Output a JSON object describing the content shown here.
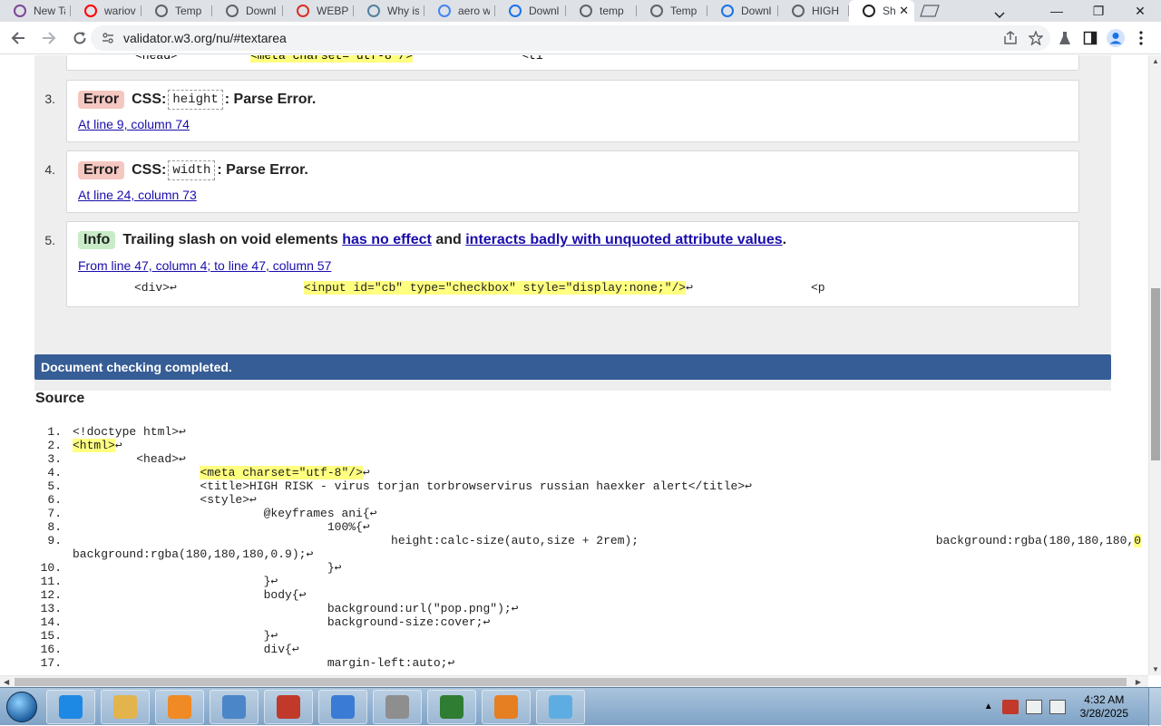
{
  "browser": {
    "tabs": [
      {
        "title": "New Tab",
        "icon": "tor-icon",
        "color": "#7d4698"
      },
      {
        "title": "wariov",
        "icon": "youtube-icon",
        "color": "#ff0000"
      },
      {
        "title": "Temp",
        "icon": "globe-icon",
        "color": "#5f6368"
      },
      {
        "title": "Downl",
        "icon": "globe-icon",
        "color": "#5f6368"
      },
      {
        "title": "WEBP",
        "icon": "webp-icon",
        "color": "#d93025"
      },
      {
        "title": "Why is",
        "icon": "java-icon",
        "color": "#5382a1"
      },
      {
        "title": "aero w",
        "icon": "google-icon",
        "color": "#4285f4"
      },
      {
        "title": "Downl",
        "icon": "diamond-icon",
        "color": "#1a73e8"
      },
      {
        "title": "temp",
        "icon": "globe-icon",
        "color": "#5f6368"
      },
      {
        "title": "Temp",
        "icon": "globe-icon",
        "color": "#5f6368"
      },
      {
        "title": "Downl",
        "icon": "download-icon",
        "color": "#1a73e8"
      },
      {
        "title": "HIGH",
        "icon": "globe-icon",
        "color": "#5f6368"
      },
      {
        "title": "Sh",
        "icon": "w3c-icon",
        "color": "#202124",
        "active": true
      }
    ],
    "close_tab": "✕",
    "url": "validator.w3.org/nu/#textarea",
    "window_controls": {
      "minimize": "—",
      "maximize": "❐",
      "close": "✕"
    }
  },
  "messages": [
    {
      "number": "3.",
      "type": "Error",
      "prefix": "CSS:",
      "code": "height",
      "text": ": Parse Error.",
      "location": "At line 9, column 74"
    },
    {
      "number": "4.",
      "type": "Error",
      "prefix": "CSS:",
      "code": "width",
      "text": ": Parse Error.",
      "location": "At line 24, column 73"
    },
    {
      "number": "5.",
      "type": "Info",
      "text_a": "Trailing slash on void elements",
      "link_a": "has no effect",
      "text_b": "and",
      "link_b": "interacts badly with unquoted attribute values",
      "text_c": ".",
      "location": "From line 47, column 4; to line 47, column 57",
      "extract_before": "<div>↩",
      "extract_highlight": "<input id=\"cb\" type=\"checkbox\" style=\"display:none;\"/>",
      "extract_after_mark": "↩",
      "extract_tail": "<p"
    }
  ],
  "partial_top": {
    "head": "<head>",
    "meta": "<meta charset=\"utf-8\"/>",
    "tail": "<ti"
  },
  "banner": "Document checking completed.",
  "source_heading": "Source",
  "source_lines": [
    {
      "n": "1.",
      "pre": "<!doctype html>↩",
      "hl": "",
      "post": ""
    },
    {
      "n": "2.",
      "pre": "",
      "hl": "<html>",
      "post": "↩"
    },
    {
      "n": "3.",
      "pre": "         <head>↩",
      "hl": "",
      "post": ""
    },
    {
      "n": "4.",
      "pre": "                  ",
      "hl": "<meta charset=\"utf-8\"/>",
      "post": "↩"
    },
    {
      "n": "5.",
      "pre": "                  <title>HIGH RISK - virus torjan torbrowservirus russian haexker alert</title>↩",
      "hl": "",
      "post": ""
    },
    {
      "n": "6.",
      "pre": "                  <style>↩",
      "hl": "",
      "post": ""
    },
    {
      "n": "7.",
      "pre": "                           @keyframes ani{↩",
      "hl": "",
      "post": ""
    },
    {
      "n": "8.",
      "pre": "                                    100%{↩",
      "hl": "",
      "post": ""
    },
    {
      "n": "9.",
      "pre": "                                             height:calc-size(auto,size + 2rem);                                          background:rgba(180,180,180,",
      "hl": "0",
      "post": ""
    },
    {
      "n": "",
      "pre": "background:rgba(180,180,180,0.9);↩",
      "hl": "",
      "post": ""
    },
    {
      "n": "10.",
      "pre": "                                    }↩",
      "hl": "",
      "post": ""
    },
    {
      "n": "11.",
      "pre": "                           }↩",
      "hl": "",
      "post": ""
    },
    {
      "n": "12.",
      "pre": "                           body{↩",
      "hl": "",
      "post": ""
    },
    {
      "n": "13.",
      "pre": "                                    background:url(\"pop.png\");↩",
      "hl": "",
      "post": ""
    },
    {
      "n": "14.",
      "pre": "                                    background-size:cover;↩",
      "hl": "",
      "post": ""
    },
    {
      "n": "15.",
      "pre": "                           }↩",
      "hl": "",
      "post": ""
    },
    {
      "n": "16.",
      "pre": "                           div{↩",
      "hl": "",
      "post": ""
    },
    {
      "n": "17.",
      "pre": "                                    margin-left:auto;↩",
      "hl": "",
      "post": ""
    }
  ],
  "taskbar": {
    "clock_time": "4:32 AM",
    "clock_date": "3/28/2025",
    "items": [
      {
        "name": "ie",
        "color": "#1e88e5"
      },
      {
        "name": "explorer",
        "color": "#e3b34c"
      },
      {
        "name": "media-player",
        "color": "#f08a24"
      },
      {
        "name": "display",
        "color": "#4a86c8"
      },
      {
        "name": "toolbox",
        "color": "#c0392b"
      },
      {
        "name": "control-panel",
        "color": "#3a7bd5"
      },
      {
        "name": "tools",
        "color": "#8e8e8e"
      },
      {
        "name": "browser-globe",
        "color": "#2e7d32"
      },
      {
        "name": "paint",
        "color": "#e67e22"
      },
      {
        "name": "notepad",
        "color": "#5dade2"
      }
    ]
  }
}
